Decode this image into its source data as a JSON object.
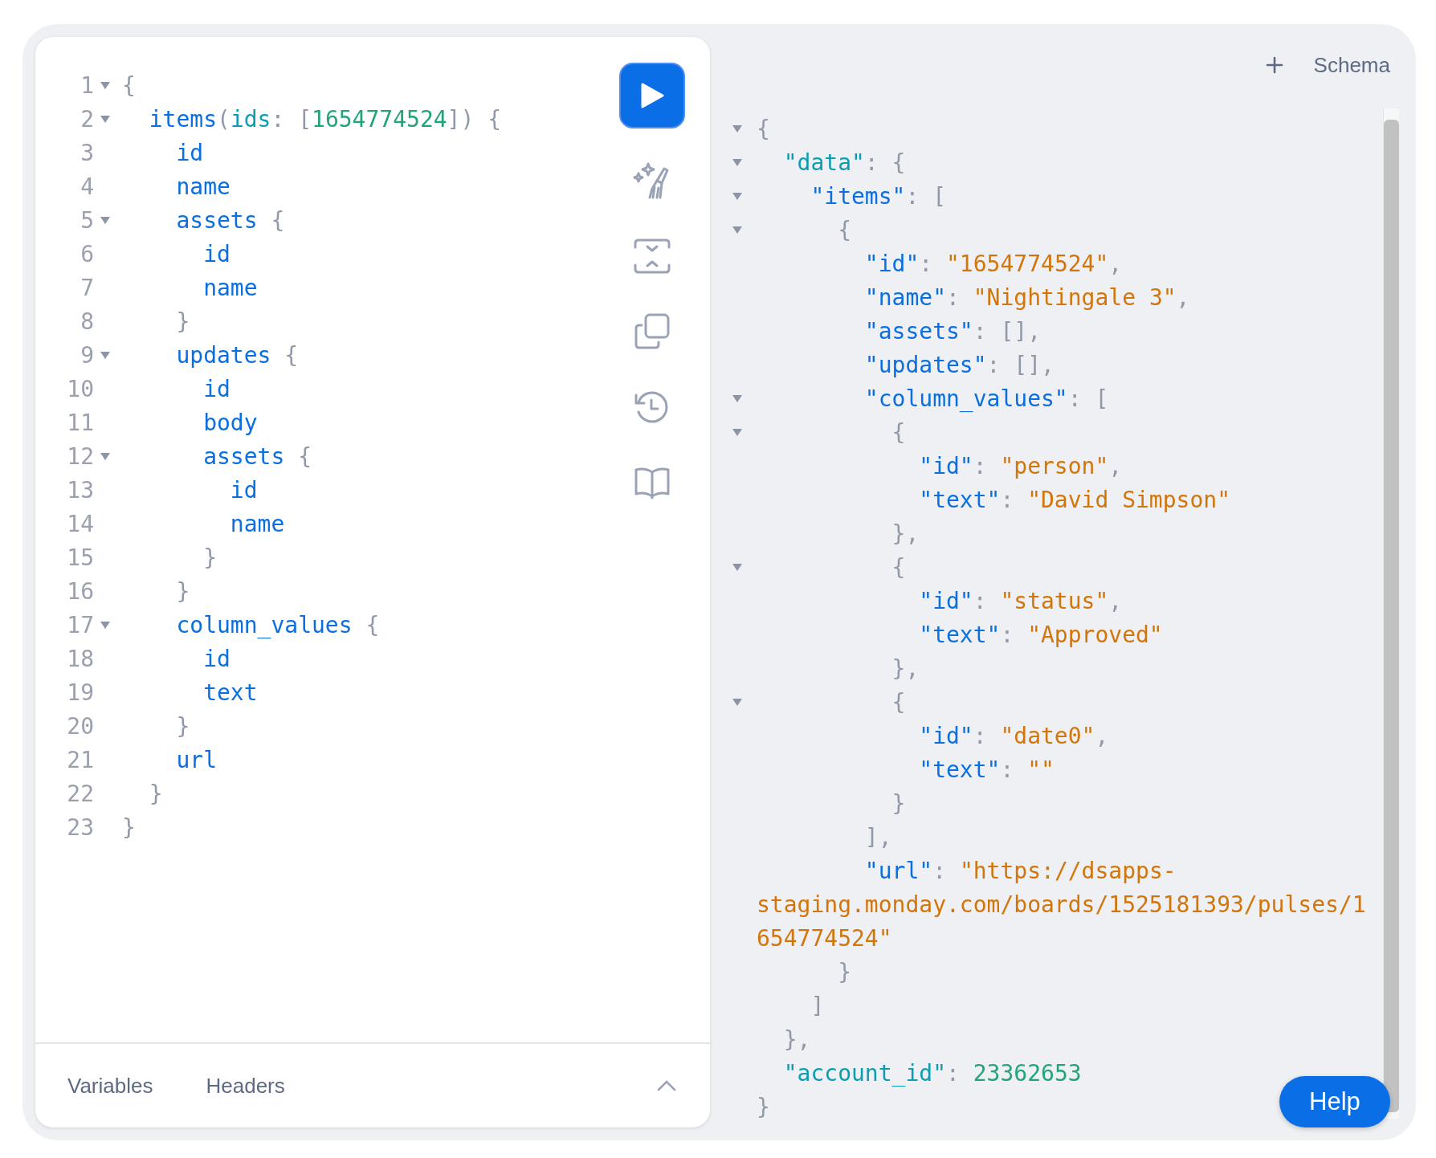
{
  "editor": {
    "lines": [
      {
        "number": "1",
        "foldable": true,
        "tokens": [
          {
            "kind": "punct",
            "text": "{"
          }
        ]
      },
      {
        "number": "2",
        "foldable": true,
        "tokens": [
          {
            "kind": "field",
            "text": "  items"
          },
          {
            "kind": "punct",
            "text": "("
          },
          {
            "kind": "argument",
            "text": "ids"
          },
          {
            "kind": "punct",
            "text": ": ["
          },
          {
            "kind": "number",
            "text": "1654774524"
          },
          {
            "kind": "punct",
            "text": "]) {"
          }
        ]
      },
      {
        "number": "3",
        "foldable": false,
        "tokens": [
          {
            "kind": "field",
            "text": "    id"
          }
        ]
      },
      {
        "number": "4",
        "foldable": false,
        "tokens": [
          {
            "kind": "field",
            "text": "    name"
          }
        ]
      },
      {
        "number": "5",
        "foldable": true,
        "tokens": [
          {
            "kind": "field",
            "text": "    assets"
          },
          {
            "kind": "punct",
            "text": " {"
          }
        ]
      },
      {
        "number": "6",
        "foldable": false,
        "tokens": [
          {
            "kind": "field",
            "text": "      id"
          }
        ]
      },
      {
        "number": "7",
        "foldable": false,
        "tokens": [
          {
            "kind": "field",
            "text": "      name"
          }
        ]
      },
      {
        "number": "8",
        "foldable": false,
        "tokens": [
          {
            "kind": "punct",
            "text": "    }"
          }
        ]
      },
      {
        "number": "9",
        "foldable": true,
        "tokens": [
          {
            "kind": "field",
            "text": "    updates"
          },
          {
            "kind": "punct",
            "text": " {"
          }
        ]
      },
      {
        "number": "10",
        "foldable": false,
        "tokens": [
          {
            "kind": "field",
            "text": "      id"
          }
        ]
      },
      {
        "number": "11",
        "foldable": false,
        "tokens": [
          {
            "kind": "field",
            "text": "      body"
          }
        ]
      },
      {
        "number": "12",
        "foldable": true,
        "tokens": [
          {
            "kind": "field",
            "text": "      assets"
          },
          {
            "kind": "punct",
            "text": " {"
          }
        ]
      },
      {
        "number": "13",
        "foldable": false,
        "tokens": [
          {
            "kind": "field",
            "text": "        id"
          }
        ]
      },
      {
        "number": "14",
        "foldable": false,
        "tokens": [
          {
            "kind": "field",
            "text": "        name"
          }
        ]
      },
      {
        "number": "15",
        "foldable": false,
        "tokens": [
          {
            "kind": "punct",
            "text": "      }"
          }
        ]
      },
      {
        "number": "16",
        "foldable": false,
        "tokens": [
          {
            "kind": "punct",
            "text": "    }"
          }
        ]
      },
      {
        "number": "17",
        "foldable": true,
        "tokens": [
          {
            "kind": "field",
            "text": "    column_values"
          },
          {
            "kind": "punct",
            "text": " {"
          }
        ]
      },
      {
        "number": "18",
        "foldable": false,
        "tokens": [
          {
            "kind": "field",
            "text": "      id"
          }
        ]
      },
      {
        "number": "19",
        "foldable": false,
        "tokens": [
          {
            "kind": "field",
            "text": "      text"
          }
        ]
      },
      {
        "number": "20",
        "foldable": false,
        "tokens": [
          {
            "kind": "punct",
            "text": "    }"
          }
        ]
      },
      {
        "number": "21",
        "foldable": false,
        "tokens": [
          {
            "kind": "field",
            "text": "    url"
          }
        ]
      },
      {
        "number": "22",
        "foldable": false,
        "tokens": [
          {
            "kind": "punct",
            "text": "  }"
          }
        ]
      },
      {
        "number": "23",
        "foldable": false,
        "tokens": [
          {
            "kind": "punct",
            "text": "}"
          }
        ]
      }
    ]
  },
  "editor_tabs": [
    {
      "label": "Variables",
      "selected": false
    },
    {
      "label": "Headers",
      "selected": false
    }
  ],
  "header": {
    "schema_label": "Schema"
  },
  "results": {
    "lines": [
      {
        "foldable": true,
        "tokens": [
          {
            "kind": "punct",
            "text": "{"
          }
        ]
      },
      {
        "foldable": true,
        "tokens": [
          {
            "kind": "top_key",
            "text": "  \"data\""
          },
          {
            "kind": "punct",
            "text": ": {"
          }
        ]
      },
      {
        "foldable": true,
        "tokens": [
          {
            "kind": "key",
            "text": "    \"items\""
          },
          {
            "kind": "punct",
            "text": ": ["
          }
        ]
      },
      {
        "foldable": true,
        "tokens": [
          {
            "kind": "punct",
            "text": "      {"
          }
        ]
      },
      {
        "foldable": false,
        "tokens": [
          {
            "kind": "key",
            "text": "        \"id\""
          },
          {
            "kind": "punct",
            "text": ": "
          },
          {
            "kind": "string",
            "text": "\"1654774524\""
          },
          {
            "kind": "punct",
            "text": ","
          }
        ]
      },
      {
        "foldable": false,
        "tokens": [
          {
            "kind": "key",
            "text": "        \"name\""
          },
          {
            "kind": "punct",
            "text": ": "
          },
          {
            "kind": "string",
            "text": "\"Nightingale 3\""
          },
          {
            "kind": "punct",
            "text": ","
          }
        ]
      },
      {
        "foldable": false,
        "tokens": [
          {
            "kind": "key",
            "text": "        \"assets\""
          },
          {
            "kind": "punct",
            "text": ": [],"
          }
        ]
      },
      {
        "foldable": false,
        "tokens": [
          {
            "kind": "key",
            "text": "        \"updates\""
          },
          {
            "kind": "punct",
            "text": ": [],"
          }
        ]
      },
      {
        "foldable": true,
        "tokens": [
          {
            "kind": "key",
            "text": "        \"column_values\""
          },
          {
            "kind": "punct",
            "text": ": ["
          }
        ]
      },
      {
        "foldable": true,
        "tokens": [
          {
            "kind": "punct",
            "text": "          {"
          }
        ]
      },
      {
        "foldable": false,
        "tokens": [
          {
            "kind": "key",
            "text": "            \"id\""
          },
          {
            "kind": "punct",
            "text": ": "
          },
          {
            "kind": "string",
            "text": "\"person\""
          },
          {
            "kind": "punct",
            "text": ","
          }
        ]
      },
      {
        "foldable": false,
        "tokens": [
          {
            "kind": "key",
            "text": "            \"text\""
          },
          {
            "kind": "punct",
            "text": ": "
          },
          {
            "kind": "string",
            "text": "\"David Simpson\""
          }
        ]
      },
      {
        "foldable": false,
        "tokens": [
          {
            "kind": "punct",
            "text": "          },"
          }
        ]
      },
      {
        "foldable": true,
        "tokens": [
          {
            "kind": "punct",
            "text": "          {"
          }
        ]
      },
      {
        "foldable": false,
        "tokens": [
          {
            "kind": "key",
            "text": "            \"id\""
          },
          {
            "kind": "punct",
            "text": ": "
          },
          {
            "kind": "string",
            "text": "\"status\""
          },
          {
            "kind": "punct",
            "text": ","
          }
        ]
      },
      {
        "foldable": false,
        "tokens": [
          {
            "kind": "key",
            "text": "            \"text\""
          },
          {
            "kind": "punct",
            "text": ": "
          },
          {
            "kind": "string",
            "text": "\"Approved\""
          }
        ]
      },
      {
        "foldable": false,
        "tokens": [
          {
            "kind": "punct",
            "text": "          },"
          }
        ]
      },
      {
        "foldable": true,
        "tokens": [
          {
            "kind": "punct",
            "text": "          {"
          }
        ]
      },
      {
        "foldable": false,
        "tokens": [
          {
            "kind": "key",
            "text": "            \"id\""
          },
          {
            "kind": "punct",
            "text": ": "
          },
          {
            "kind": "string",
            "text": "\"date0\""
          },
          {
            "kind": "punct",
            "text": ","
          }
        ]
      },
      {
        "foldable": false,
        "tokens": [
          {
            "kind": "key",
            "text": "            \"text\""
          },
          {
            "kind": "punct",
            "text": ": "
          },
          {
            "kind": "string",
            "text": "\"\""
          }
        ]
      },
      {
        "foldable": false,
        "tokens": [
          {
            "kind": "punct",
            "text": "          }"
          }
        ]
      },
      {
        "foldable": false,
        "tokens": [
          {
            "kind": "punct",
            "text": "        ],"
          }
        ]
      },
      {
        "foldable": false,
        "tokens": [
          {
            "kind": "key",
            "text": "        \"url\""
          },
          {
            "kind": "punct",
            "text": ": "
          },
          {
            "kind": "string",
            "text": "\"https://dsapps-"
          }
        ]
      },
      {
        "foldable": false,
        "tokens": [
          {
            "kind": "string",
            "text": "staging.monday.com/boards/1525181393/pulses/1"
          }
        ]
      },
      {
        "foldable": false,
        "tokens": [
          {
            "kind": "string",
            "text": "654774524\""
          }
        ]
      },
      {
        "foldable": false,
        "tokens": [
          {
            "kind": "punct",
            "text": "      }"
          }
        ]
      },
      {
        "foldable": false,
        "tokens": [
          {
            "kind": "punct",
            "text": "    ]"
          }
        ]
      },
      {
        "foldable": false,
        "tokens": [
          {
            "kind": "punct",
            "text": "  },"
          }
        ]
      },
      {
        "foldable": false,
        "tokens": [
          {
            "kind": "top_key",
            "text": "  \"account_id\""
          },
          {
            "kind": "punct",
            "text": ": "
          },
          {
            "kind": "number",
            "text": "23362653"
          }
        ]
      },
      {
        "foldable": false,
        "tokens": [
          {
            "kind": "punct",
            "text": "}"
          }
        ]
      }
    ]
  },
  "help_button": "Help"
}
